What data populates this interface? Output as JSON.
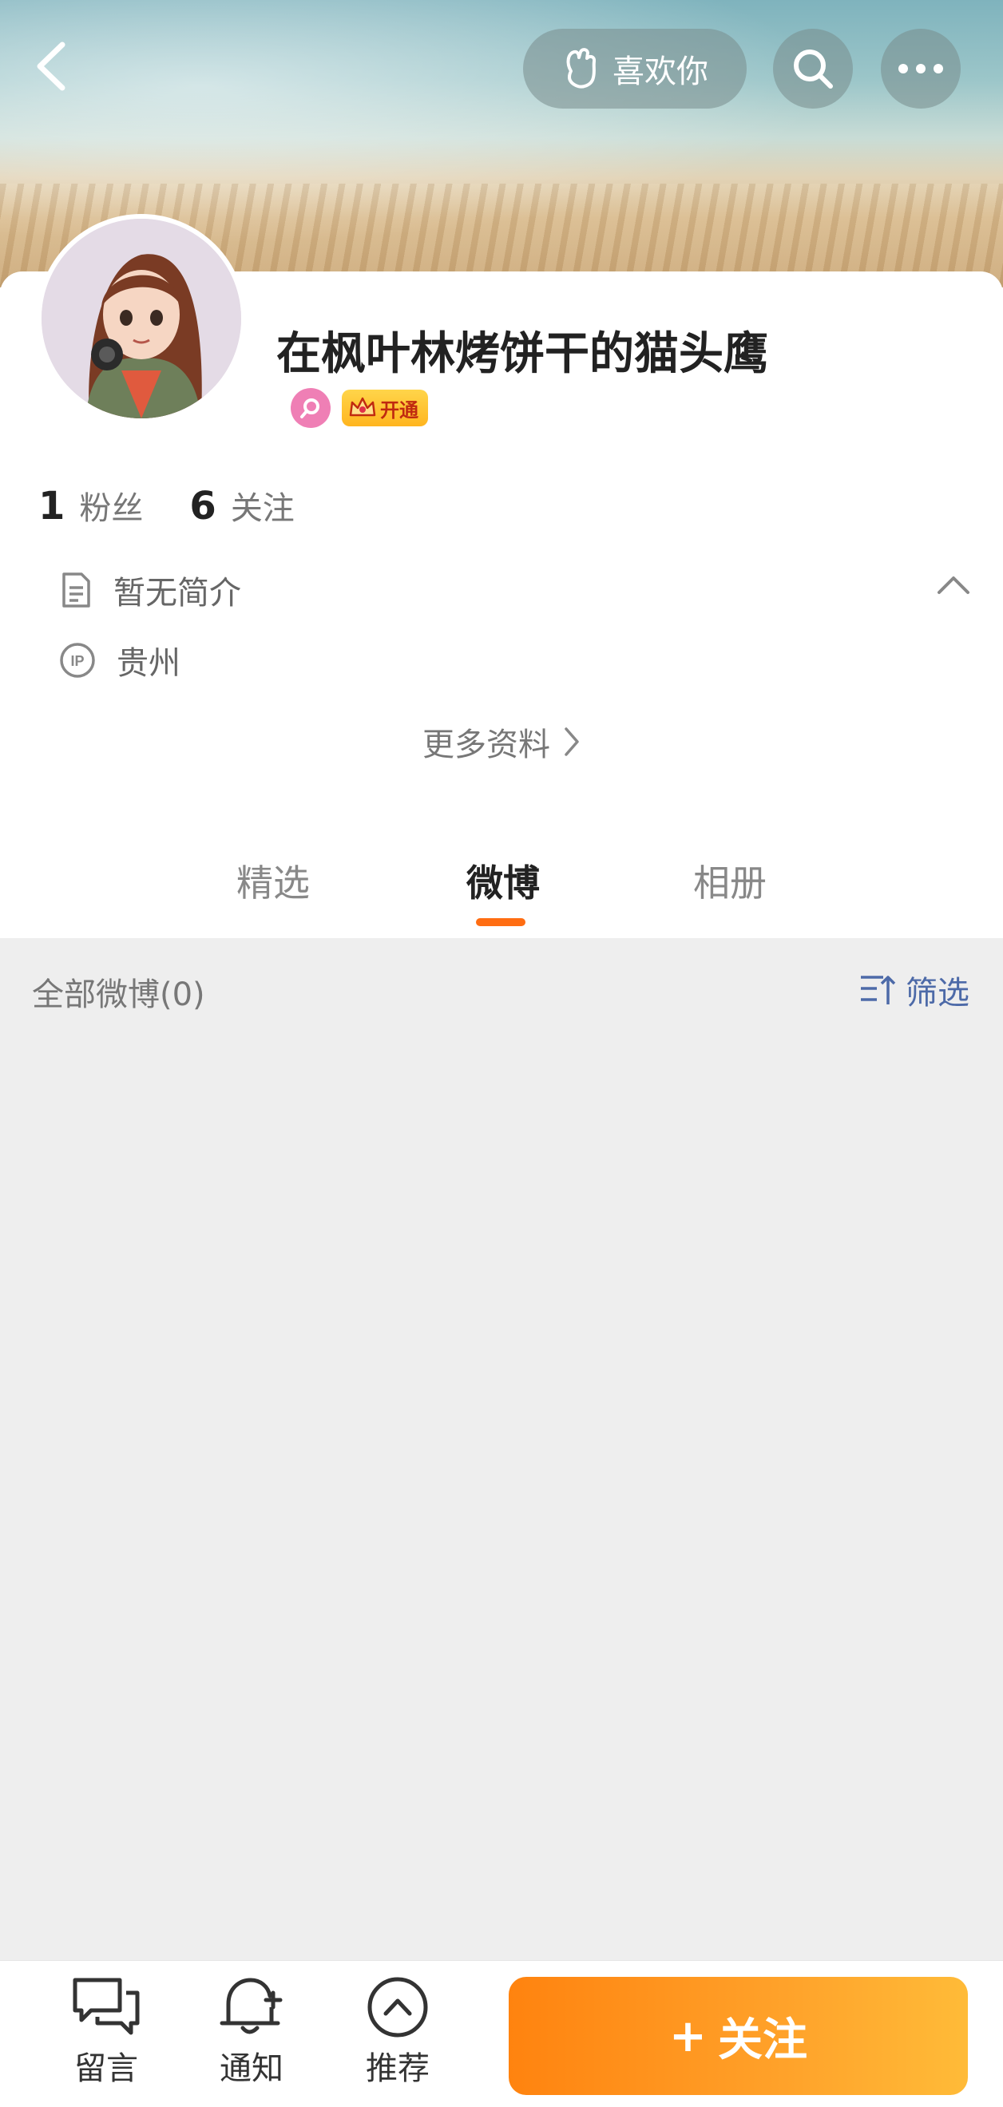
{
  "header": {
    "like_button_label": "喜欢你",
    "icons": [
      "back-icon",
      "heart-hand-icon",
      "search-icon",
      "more-icon"
    ]
  },
  "profile": {
    "username": "在枫叶林烤饼干的猫头鹰",
    "vip_badge_label": "开通",
    "followers_count": "1",
    "followers_label": "粉丝",
    "following_count": "6",
    "following_label": "关注",
    "bio": "暂无简介",
    "ip_location": "贵州",
    "more_info_label": "更多资料"
  },
  "tabs": [
    {
      "label": "精选",
      "active": false
    },
    {
      "label": "微博",
      "active": true
    },
    {
      "label": "相册",
      "active": false
    }
  ],
  "feed": {
    "title": "全部微博(0)",
    "filter_label": "筛选"
  },
  "bottom_bar": {
    "items": [
      {
        "label": "留言",
        "icon": "message-icon"
      },
      {
        "label": "通知",
        "icon": "bell-plus-icon"
      },
      {
        "label": "推荐",
        "icon": "chevron-up-circle-icon"
      }
    ],
    "follow_label": "关注",
    "follow_prefix": "+"
  },
  "colors": {
    "accent": "#ff6d12",
    "follow_gradient_start": "#ff830f",
    "follow_gradient_end": "#ffbb38",
    "filter_blue": "#4d6aa8",
    "feed_bg": "#eeeeee"
  }
}
